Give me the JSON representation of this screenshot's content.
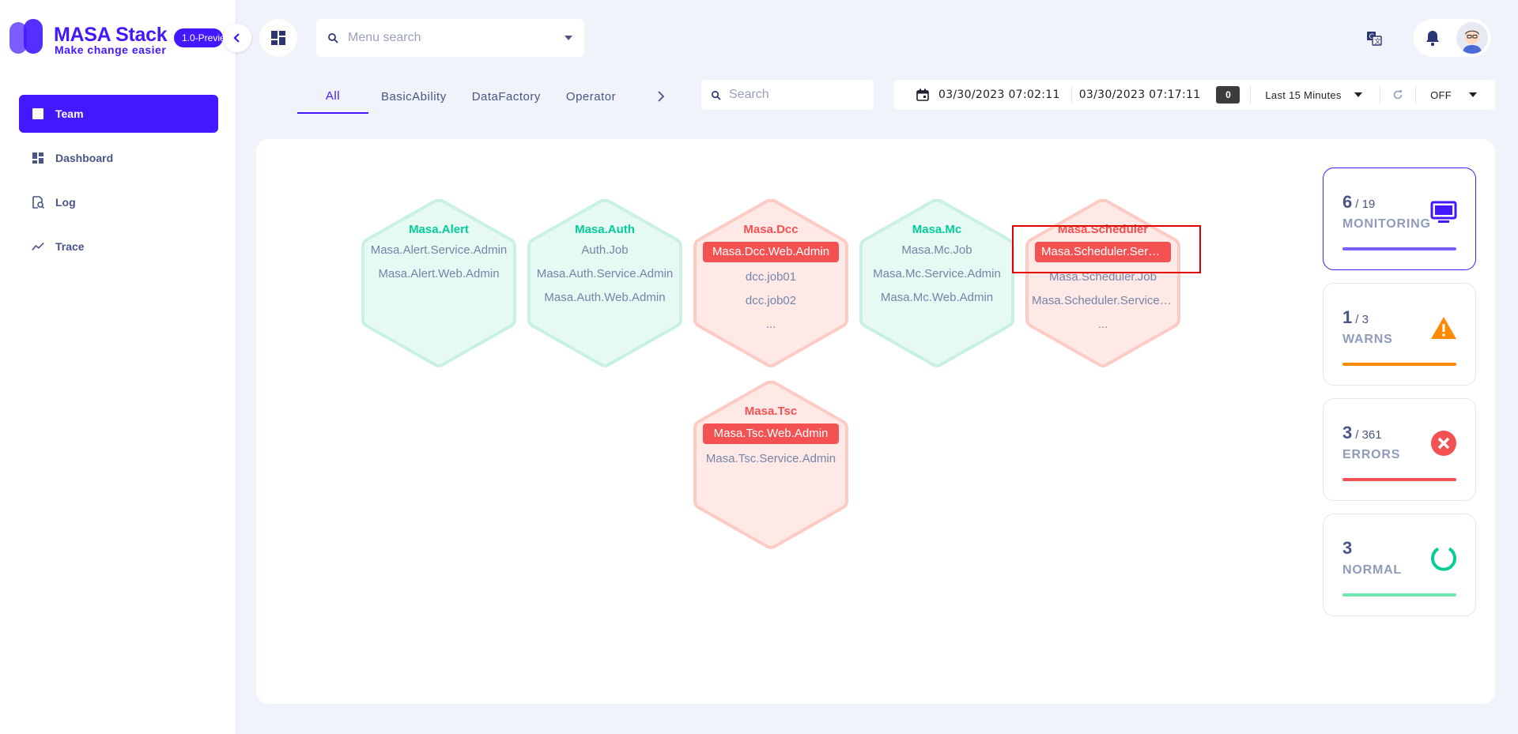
{
  "brand": {
    "name": "MASA Stack",
    "tagline": "Make change easier",
    "version": "1.0-Preview"
  },
  "sidebar": {
    "items": [
      {
        "label": "Team"
      },
      {
        "label": "Dashboard"
      },
      {
        "label": "Log"
      },
      {
        "label": "Trace"
      }
    ]
  },
  "header": {
    "menu_search_placeholder": "Menu search"
  },
  "tabs": [
    {
      "label": "All"
    },
    {
      "label": "BasicAbility"
    },
    {
      "label": "DataFactory"
    },
    {
      "label": "Operator"
    }
  ],
  "search": {
    "placeholder": "Search"
  },
  "timebar": {
    "start": "03/30/2023 07:02:11",
    "end": "03/30/2023 07:17:11",
    "badge": "0",
    "range": "Last 15 Minutes",
    "refresh": "OFF"
  },
  "services": [
    {
      "title": "Masa.Alert",
      "status": "ok",
      "lines": [
        {
          "text": "Masa.Alert.Service.Admin",
          "highlight": false
        },
        {
          "text": "Masa.Alert.Web.Admin",
          "highlight": false
        }
      ]
    },
    {
      "title": "Masa.Auth",
      "status": "ok",
      "lines": [
        {
          "text": "Auth.Job",
          "highlight": false
        },
        {
          "text": "Masa.Auth.Service.Admin",
          "highlight": false
        },
        {
          "text": "Masa.Auth.Web.Admin",
          "highlight": false
        }
      ]
    },
    {
      "title": "Masa.Dcc",
      "status": "err",
      "lines": [
        {
          "text": "Masa.Dcc.Web.Admin",
          "highlight": true
        },
        {
          "text": "dcc.job01",
          "highlight": false
        },
        {
          "text": "dcc.job02",
          "highlight": false
        },
        {
          "text": "...",
          "highlight": false
        }
      ]
    },
    {
      "title": "Masa.Mc",
      "status": "ok",
      "lines": [
        {
          "text": "Masa.Mc.Job",
          "highlight": false
        },
        {
          "text": "Masa.Mc.Service.Admin",
          "highlight": false
        },
        {
          "text": "Masa.Mc.Web.Admin",
          "highlight": false
        }
      ]
    },
    {
      "title": "Masa.Scheduler",
      "status": "err",
      "lines": [
        {
          "text": "Masa.Scheduler.Service",
          "highlight": true
        },
        {
          "text": "Masa.Scheduler.Job",
          "highlight": false
        },
        {
          "text": "Masa.Scheduler.Service.Admin",
          "highlight": false
        },
        {
          "text": "...",
          "highlight": false
        }
      ]
    },
    {
      "title": "Masa.Tsc",
      "status": "err",
      "lines": [
        {
          "text": "Masa.Tsc.Web.Admin",
          "highlight": true
        },
        {
          "text": "Masa.Tsc.Service.Admin",
          "highlight": false
        }
      ]
    }
  ],
  "stats": [
    {
      "value": "6",
      "total": "/ 19",
      "label": "MONITORING",
      "color": "#7b5cff"
    },
    {
      "value": "1",
      "total": "/ 3",
      "label": "WARNS",
      "color": "#ff8a00"
    },
    {
      "value": "3",
      "total": "/ 361",
      "label": "ERRORS",
      "color": "#f45252"
    },
    {
      "value": "3",
      "total": "",
      "label": "NORMAL",
      "color": "#6ee7b0"
    }
  ],
  "colors": {
    "accent": "#4318ff",
    "ok": "#05cd99",
    "error": "#f45252",
    "warn": "#ff8a00"
  }
}
